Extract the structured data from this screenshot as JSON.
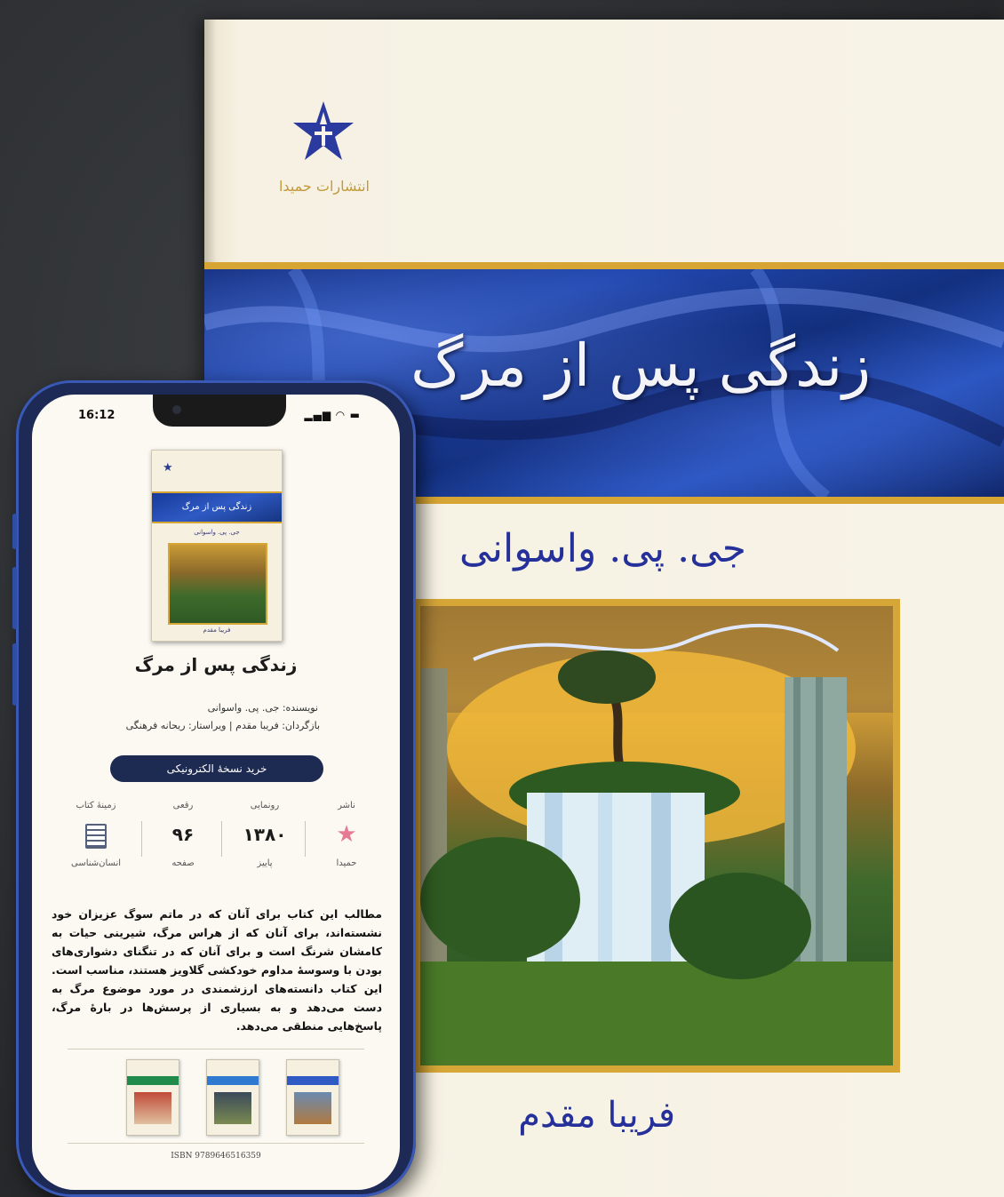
{
  "cover": {
    "publisher_name": "انتشارات حمیدا",
    "title": "زندگی پس از مرگ",
    "author": "جی. پی. واسوانی",
    "translator": "فریبا مقدم"
  },
  "phone": {
    "status_time": "16:12",
    "book_title": "زندگی پس از مرگ",
    "credits": {
      "author_line": "نویسنده: جی. پی. واسوانی",
      "translator_line": "بازگردان: فریبا مقدم | ویراستار: ریحانه فرهنگی"
    },
    "buy_button": "خرید نسخهٔ الکترونیکی",
    "info": {
      "publisher": {
        "label": "ناشر",
        "sub": "حمیدا"
      },
      "release": {
        "label": "رونمایی",
        "value": "۱۳۸۰",
        "sub": "پاییز"
      },
      "pages": {
        "label": "رقعی",
        "value": "۹۶",
        "sub": "صفحه"
      },
      "category": {
        "label": "زمینهٔ کتاب",
        "sub": "انسان‌شناسی"
      }
    },
    "description": "مطالب این کتاب برای آنان که در ماتم سوگ عزیزان خود نشسته‌اند، برای آنان که از هراس مرگ، شیرینی حیات به کامشان شرنگ است و برای آنان که در تنگنای دشواری‌های بودن با وسوسهٔ مداوم خودکشی گلاویز هستند، مناسب است. این کتاب دانسته‌های ارزشمندی در مورد موضوع مرگ به دست می‌دهد و به بسیاری از پرسش‌ها در بارهٔ مرگ، پاسخ‌هایی منطقی می‌دهد.",
    "isbn": "ISBN 9789646516359"
  },
  "colors": {
    "brand_blue": "#25309a",
    "gold": "#d7a534",
    "button_navy": "#1d2a52"
  }
}
